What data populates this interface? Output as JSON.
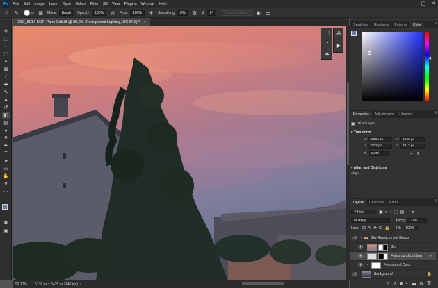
{
  "app": {
    "logo": "Ps"
  },
  "menu": [
    "File",
    "Edit",
    "Image",
    "Layer",
    "Type",
    "Select",
    "Filter",
    "3D",
    "View",
    "Plugins",
    "Window",
    "Help"
  ],
  "window_controls": [
    "—",
    "▢",
    "✕"
  ],
  "options": {
    "brush_size": "30",
    "mode_label": "Mode:",
    "mode_value": "Brush",
    "opacity_label": "Opacity:",
    "opacity_value": "100%",
    "flow_label": "Flow:",
    "flow_value": "100%",
    "smoothing_label": "Smoothing:",
    "smoothing_value": "0%",
    "angle_value": "0°",
    "erase_history_label": "Erase to History"
  },
  "document": {
    "tab_title": "DSC_5014-HDR-Pano-Edit.tif @ 99,2% (Foreground Lighting, RGB/16) *",
    "tab_close": "×",
    "zoom": "99,17%",
    "info": "5138 px x 5425 px (240 ppi)"
  },
  "color_panel": {
    "tabs": [
      "Swatches",
      "Gradients",
      "Patterns",
      "Color"
    ],
    "active_tab": "Color",
    "foreground_color": "#6e7aa0",
    "background_color": "#ffffff"
  },
  "properties_panel": {
    "tabs": [
      "Properties",
      "Adjustments",
      "Libraries"
    ],
    "active_tab": "Properties",
    "layer_type": "Pixel Layer",
    "transform_title": "Transform",
    "w_label": "W:",
    "w_value": "11394 px",
    "x_label": "X:",
    "x_value": "1628 px",
    "h_label": "H:",
    "h_value": "7053 px",
    "y_label": "Y:",
    "y_value": "3813 px",
    "angle_value": "0,00°",
    "align_title": "Align and Distribute",
    "align_label": "Align:"
  },
  "layers_panel": {
    "tabs": [
      "Layers",
      "Channels",
      "Paths"
    ],
    "active_tab": "Layers",
    "filter_value": "Kind",
    "blend_mode": "Multiply",
    "opacity_label": "Opacity:",
    "opacity_value": "31%",
    "lock_label": "Lock:",
    "fill_label": "Fill:",
    "fill_value": "100%",
    "layers": [
      {
        "name": "Sky Replacement Group",
        "kind": "group"
      },
      {
        "name": "Sky",
        "kind": "layer"
      },
      {
        "name": "Foreground Lighting",
        "kind": "layer",
        "selected": true
      },
      {
        "name": "Foreground Color",
        "kind": "adjustment"
      },
      {
        "name": "Background",
        "kind": "background"
      }
    ]
  }
}
